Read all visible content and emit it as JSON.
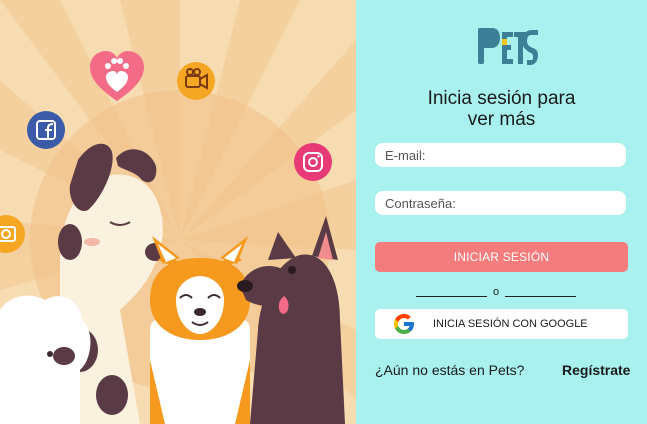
{
  "brand": {
    "logo_text": "PETS",
    "color": "#3d7f96"
  },
  "login": {
    "title_line1": "Inicia sesión para",
    "title_line2": "ver más",
    "email_placeholder": "E-mail:",
    "password_placeholder": "Contraseña:",
    "login_button": "INICIAR SESIÓN",
    "divider_text": "o",
    "google_button": "INICIA SESIÓN CON GOOGLE",
    "signup_question": "¿Aún no estás en Pets?",
    "signup_link": "Regístrate"
  },
  "colors": {
    "panel_bg": "#a8f1ee",
    "login_button": "#f47c7c",
    "illustration_bg": "#f6d6a8"
  },
  "illustration": {
    "floating_icons": [
      "heart-paw-icon",
      "video-camera-icon",
      "facebook-icon",
      "instagram-icon",
      "photo-camera-icon"
    ]
  }
}
